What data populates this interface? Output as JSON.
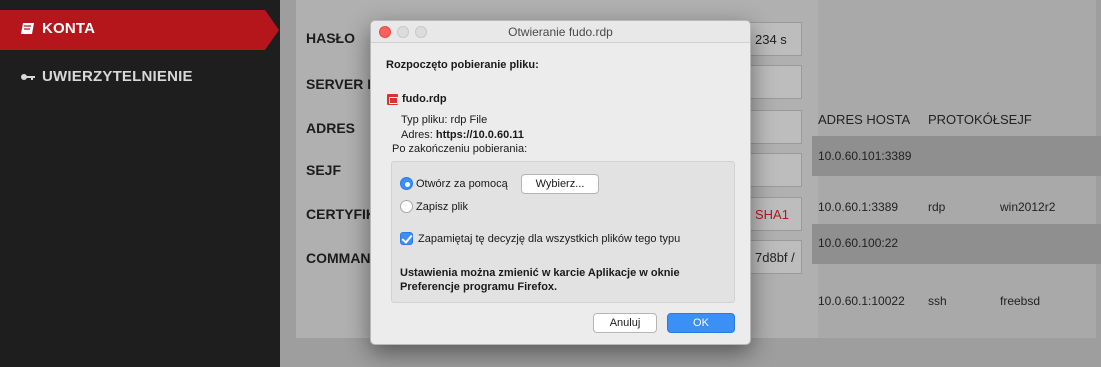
{
  "sidebar": {
    "items": [
      {
        "label": "KONTA",
        "icon": "book-icon",
        "active": true
      },
      {
        "label": "UWIERZYTELNIENIE",
        "icon": "key-icon",
        "active": false
      }
    ]
  },
  "form": {
    "labels": [
      "HASŁO",
      "SERVER NA",
      "ADRES",
      "SEJF",
      "CERTYFIKA",
      "COMMAND"
    ],
    "values": {
      "haslo": "234 s",
      "certyfikat": "SHA1",
      "command": "7d8bf /"
    }
  },
  "table": {
    "headers": [
      "ADRES HOSTA",
      "PROTOKÓŁ",
      "SEJF"
    ],
    "rows": [
      {
        "host": "10.0.60.101:3389",
        "protocol": "",
        "safe": ""
      },
      {
        "host": "10.0.60.1:3389",
        "protocol": "rdp",
        "safe": "win2012r2"
      },
      {
        "host": "10.0.60.100:22",
        "protocol": "",
        "safe": ""
      },
      {
        "host": "10.0.60.1:10022",
        "protocol": "ssh",
        "safe": "freebsd"
      }
    ]
  },
  "dialog": {
    "title": "Otwieranie fudo.rdp",
    "heading": "Rozpoczęto pobieranie pliku:",
    "filename": "fudo.rdp",
    "type_label": "Typ pliku:",
    "type_value": "rdp File",
    "address_label": "Adres:",
    "address_value": "https://10.0.60.11",
    "after_label": "Po zakończeniu pobierania:",
    "open_with_label": "Otwórz za pomocą",
    "choose_button": "Wybierz...",
    "save_label": "Zapisz plik",
    "remember_label": "Zapamiętaj tę decyzję dla wszystkich plików tego typu",
    "note_line1": "Ustawienia można zmienić w karcie Aplikacje w oknie",
    "note_line2": "Preferencje programu Firefox.",
    "cancel_button": "Anuluj",
    "ok_button": "OK"
  },
  "colors": {
    "accent": "#b5161c",
    "primary_button": "#3b8ff5"
  }
}
